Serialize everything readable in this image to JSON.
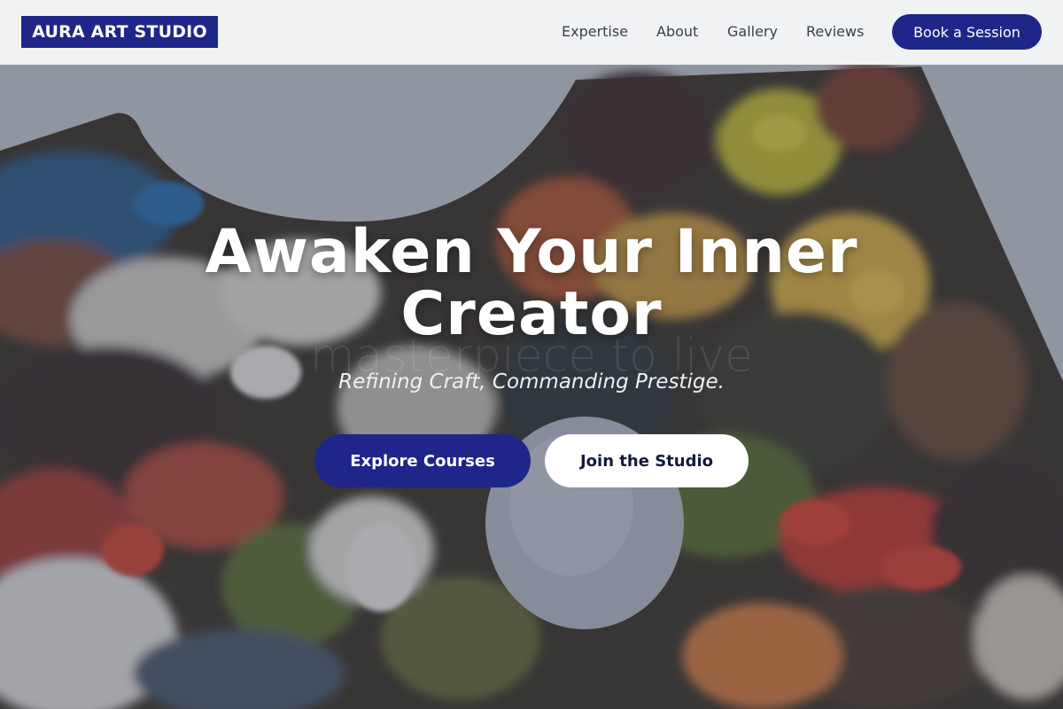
{
  "brand": {
    "name": "AURA ART STUDIO"
  },
  "nav": {
    "items": [
      {
        "label": "Expertise"
      },
      {
        "label": "About"
      },
      {
        "label": "Gallery"
      },
      {
        "label": "Reviews"
      }
    ],
    "cta_label": "Book a Session"
  },
  "hero": {
    "title": "Awaken Your Inner Creator",
    "ghost_text": "masterpiece to live",
    "subtitle": "Refining Craft, Commanding Prestige.",
    "primary_button": "Explore Courses",
    "secondary_button": "Join the Studio"
  },
  "colors": {
    "brand_navy": "#1f2689",
    "header_bg": "#f1f2f4",
    "nav_text": "#3a3f4c",
    "hero_text": "#ffffff"
  }
}
